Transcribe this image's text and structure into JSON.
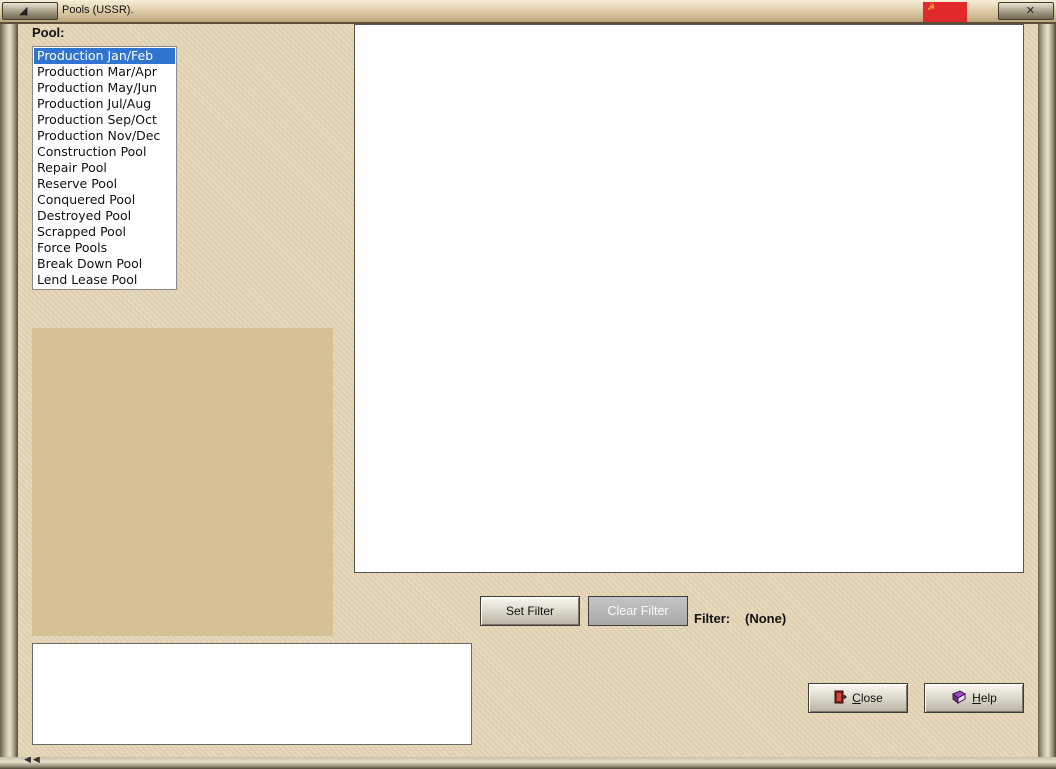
{
  "window": {
    "title": "Pools (USSR).",
    "left_cap_glyph": "◢",
    "right_cap_glyph": "✕",
    "flag_symbol": "☭",
    "flag_color": "#e0292b"
  },
  "pool_section": {
    "label": "Pool:",
    "items": [
      {
        "label": "Production Jan/Feb",
        "selected": true
      },
      {
        "label": "Production Mar/Apr",
        "selected": false
      },
      {
        "label": "Production May/Jun",
        "selected": false
      },
      {
        "label": "Production Jul/Aug",
        "selected": false
      },
      {
        "label": "Production Sep/Oct",
        "selected": false
      },
      {
        "label": "Production Nov/Dec",
        "selected": false
      },
      {
        "label": "Construction Pool",
        "selected": false
      },
      {
        "label": "Repair Pool",
        "selected": false
      },
      {
        "label": "Reserve Pool",
        "selected": false
      },
      {
        "label": "Conquered Pool",
        "selected": false
      },
      {
        "label": "Destroyed Pool",
        "selected": false
      },
      {
        "label": "Scrapped Pool",
        "selected": false
      },
      {
        "label": "Force Pools",
        "selected": false
      },
      {
        "label": "Break Down Pool",
        "selected": false
      },
      {
        "label": "Lend Lease Pool",
        "selected": false
      }
    ]
  },
  "filter": {
    "set_label": "Set Filter",
    "clear_label": "Clear Filter",
    "label": "Filter:",
    "value": "(None)"
  },
  "footer": {
    "close_label_first": "C",
    "close_label_rest": "lose",
    "help_label_first": "H",
    "help_label_rest": "elp",
    "close_icon": "door-exit-icon",
    "help_icon": "book-icon"
  }
}
